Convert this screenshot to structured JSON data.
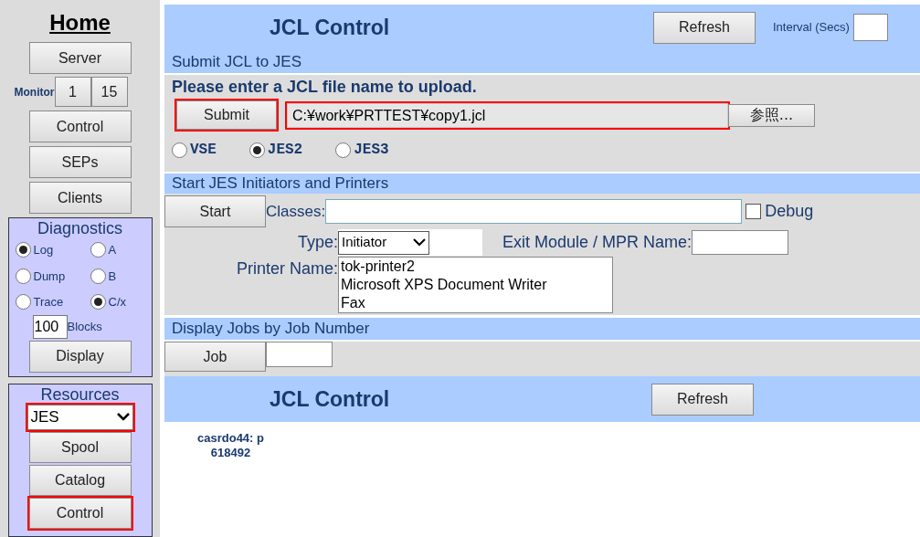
{
  "sidebar": {
    "title": "Home",
    "top_buttons": [
      {
        "label": "Server",
        "highlighted": false
      }
    ],
    "monitor": {
      "label": "Monitor",
      "buttons": [
        "1",
        "15"
      ]
    },
    "buttons": [
      {
        "label": "Control",
        "highlighted": false
      },
      {
        "label": "SEPs",
        "highlighted": false
      },
      {
        "label": "Clients",
        "highlighted": false
      }
    ],
    "diagnostics": {
      "title": "Diagnostics",
      "options": [
        {
          "label": "Log",
          "selected": true
        },
        {
          "label": "A",
          "selected": false
        },
        {
          "label": "Dump",
          "selected": false
        },
        {
          "label": "B",
          "selected": false
        },
        {
          "label": "Trace",
          "selected": false
        },
        {
          "label": "C/x",
          "selected": true
        }
      ],
      "blocks_value": "100",
      "blocks_label": "Blocks",
      "display_button": "Display"
    },
    "resources": {
      "title": "Resources",
      "select": {
        "value": "JES",
        "highlighted": true
      },
      "buttons": [
        {
          "label": "Spool",
          "highlighted": false
        },
        {
          "label": "Catalog",
          "highlighted": false
        },
        {
          "label": "Control",
          "highlighted": true
        }
      ]
    }
  },
  "header": {
    "title": "JCL Control",
    "refresh": "Refresh",
    "interval_label": "Interval (Secs)"
  },
  "submit_section": {
    "heading": "Submit JCL to JES",
    "prompt": "Please enter a JCL file name to upload.",
    "submit_button": {
      "label": "Submit",
      "highlighted": true
    },
    "file_field": {
      "value": "C:¥work¥PRTTEST¥copy1.jcl",
      "highlighted": true
    },
    "browse_button": "参照...",
    "systems": [
      {
        "label": "VSE",
        "selected": false
      },
      {
        "label": "JES2",
        "selected": true
      },
      {
        "label": "JES3",
        "selected": false
      }
    ]
  },
  "start_section": {
    "heading": "Start JES Initiators and Printers",
    "start_button": "Start",
    "classes_label": "Classes:",
    "debug": {
      "label": "Debug",
      "checked": false
    },
    "type_label": "Type:",
    "type_value": "Initiator",
    "exit_label": "Exit Module / MPR Name:",
    "printer_label": "Printer Name:",
    "printers": [
      "tok-printer2",
      "Microsoft XPS Document Writer",
      "Fax"
    ]
  },
  "jobs_section": {
    "heading": "Display Jobs by Job Number",
    "job_button": "Job"
  },
  "footer": {
    "title": "JCL Control",
    "refresh": "Refresh"
  },
  "info": [
    "casrdo44: p",
    "618492"
  ]
}
